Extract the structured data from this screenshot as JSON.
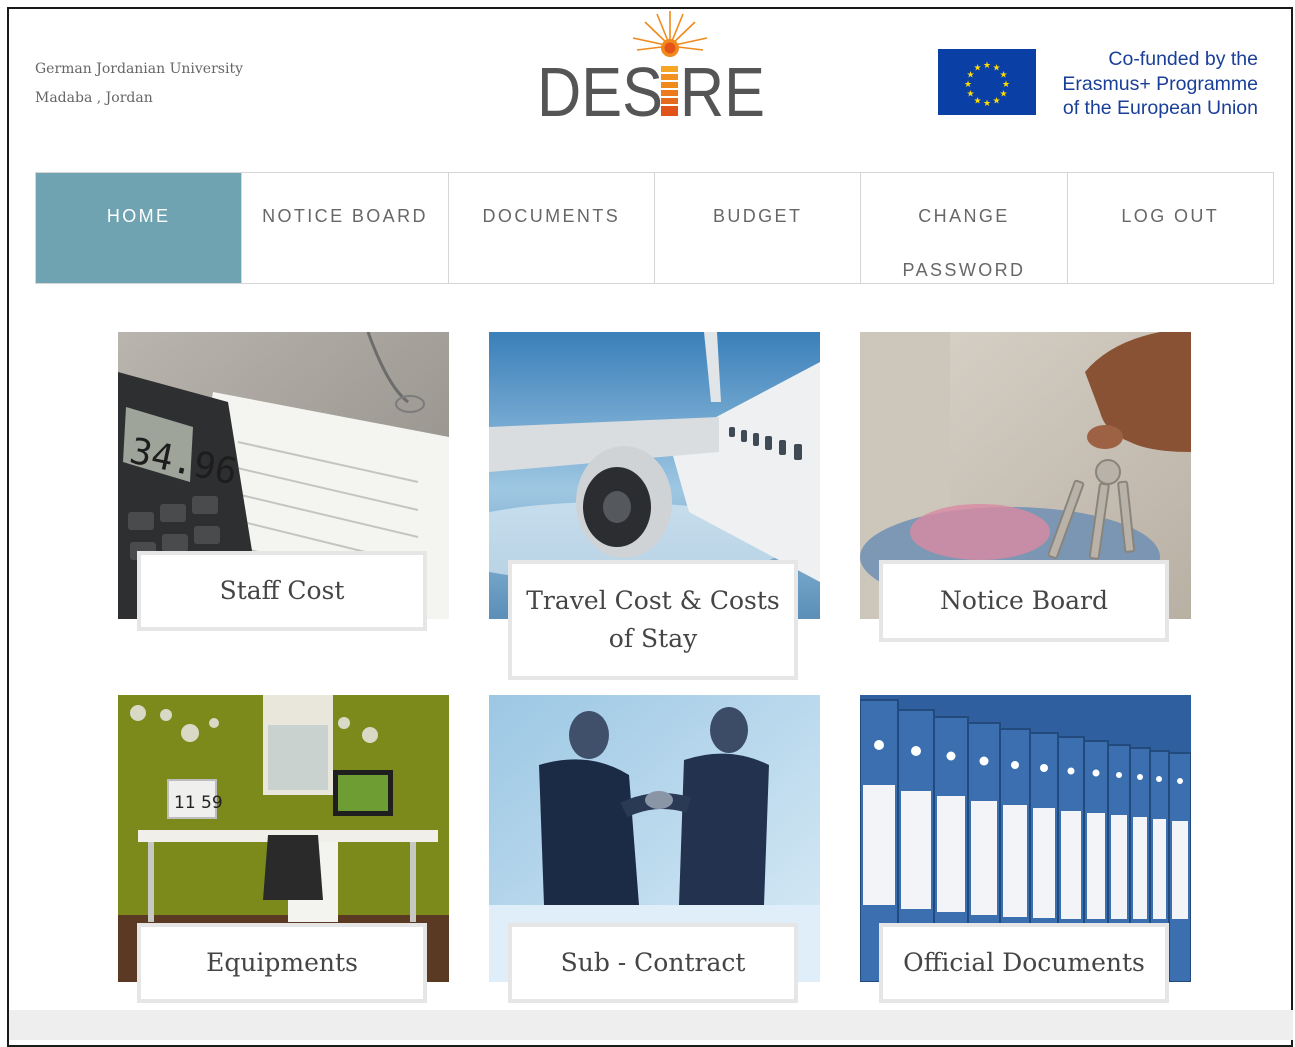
{
  "header": {
    "org_line1": "German Jordanian University",
    "org_line2": "Madaba , Jordan",
    "logo_text": "DESIRE",
    "eu_line1": "Co-funded by the",
    "eu_line2": "Erasmus+ Programme",
    "eu_line3": "of the European Union"
  },
  "nav": [
    {
      "label": "HOME",
      "active": true
    },
    {
      "label": "NOTICE BOARD"
    },
    {
      "label": "DOCUMENTS"
    },
    {
      "label": "BUDGET"
    },
    {
      "label_line1": "CHANGE",
      "label_line2": "PASSWORD"
    },
    {
      "label": "LOG OUT"
    }
  ],
  "tiles": [
    {
      "label": "Staff Cost",
      "image": "calculator-tax-form-photo"
    },
    {
      "label": "Travel Cost & Costs of Stay",
      "image": "airplane-photo"
    },
    {
      "label": "Notice Board",
      "image": "hand-holding-keys-photo"
    },
    {
      "label": "Equipments",
      "image": "home-office-photo"
    },
    {
      "label": "Sub - Contract",
      "image": "handshake-photo"
    },
    {
      "label": "Official Documents",
      "image": "blue-binders-photo"
    }
  ],
  "colors": {
    "nav_active": "#6fa3b1",
    "eu_blue": "#0a3fa6",
    "eu_text": "#1a3f98",
    "logo_gray": "#555555",
    "logo_orange": "#f08a1c"
  },
  "calculator_display": "34.96",
  "clock_display": "11 59"
}
